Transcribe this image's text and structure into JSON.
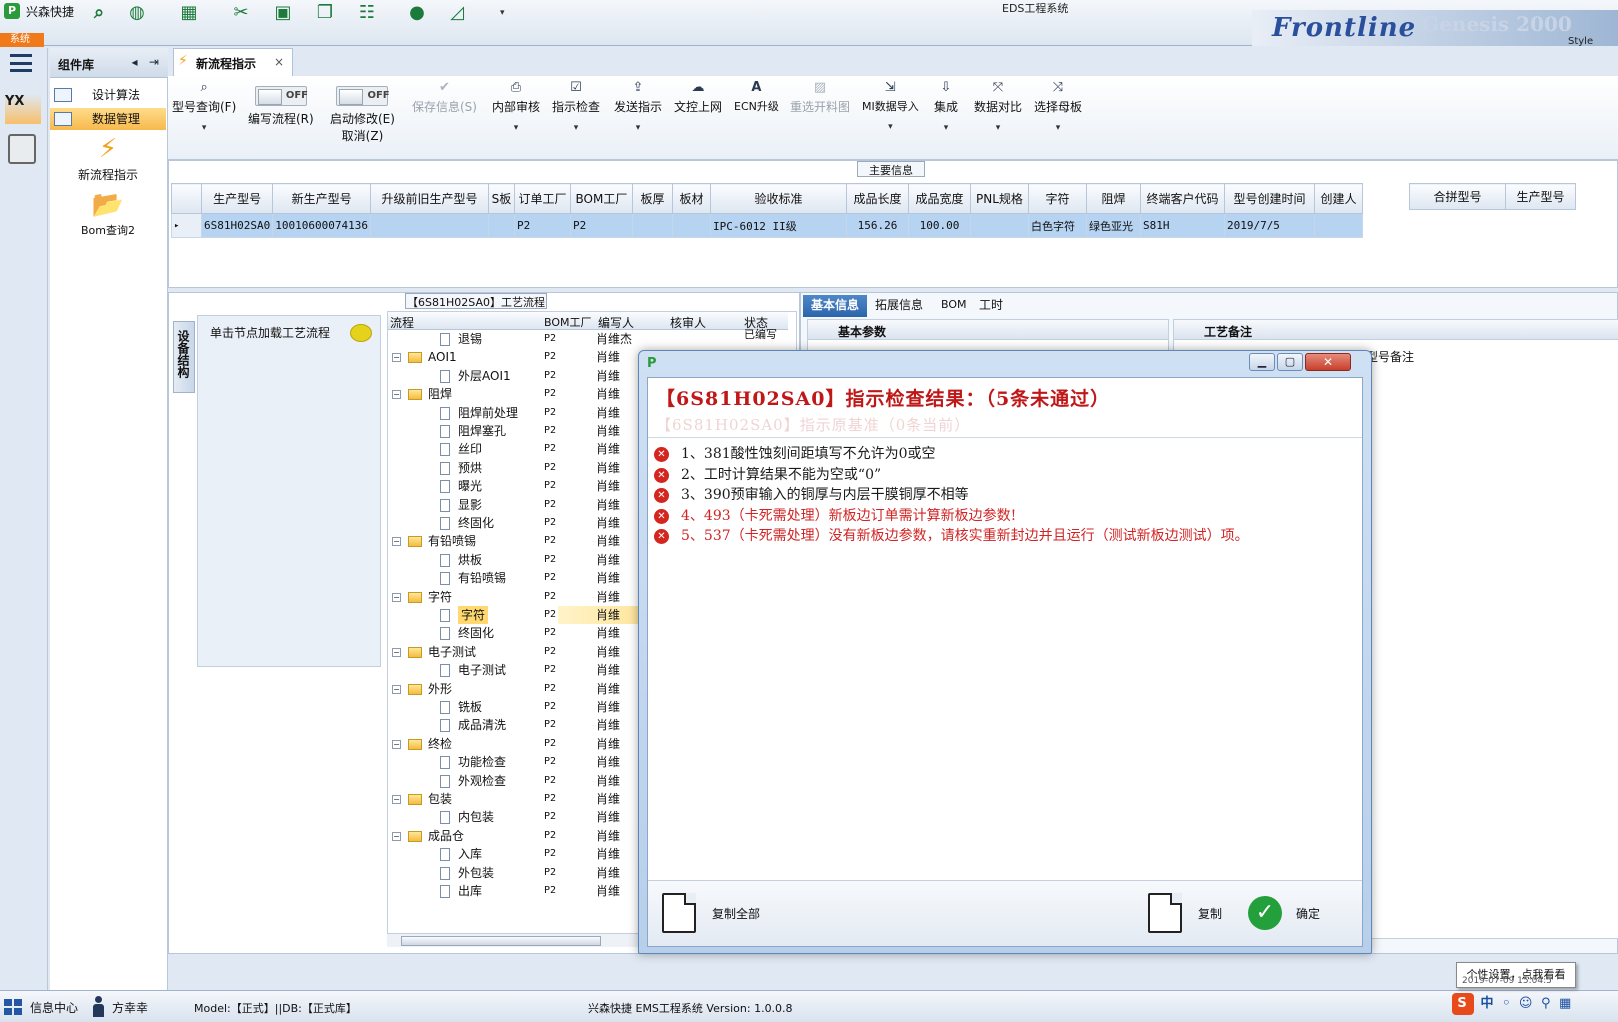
{
  "titlebar": {
    "app_name": "兴森快捷",
    "window_title": "EDS工程系统",
    "sys_tab": "系统",
    "brand_word": "Frontline",
    "brand_product": "Genesis 2000",
    "style_label": "Style"
  },
  "library": {
    "title": "组件库",
    "items": [
      {
        "label": "设计算法"
      },
      {
        "label": "数据管理"
      }
    ],
    "tools": [
      {
        "label": "新流程指示"
      },
      {
        "label": "Bom查询2"
      }
    ]
  },
  "doc_tab": {
    "label": "新流程指示"
  },
  "ribbon": {
    "buttons": [
      {
        "label": "型号查询(F)",
        "icon": "search-icon",
        "disabled": false
      },
      {
        "label": "编写流程(R)",
        "icon": "toggle-off",
        "disabled": false,
        "toggle": "OFF"
      },
      {
        "label": "启动修改(E)",
        "sub": "取消(Z)",
        "icon": "toggle-off",
        "disabled": false,
        "toggle": "OFF"
      },
      {
        "label": "保存信息(S)",
        "icon": "check-icon",
        "disabled": true
      },
      {
        "label": "内部审核",
        "icon": "printer-icon",
        "disabled": false
      },
      {
        "label": "指示检查",
        "icon": "checkbox-icon",
        "disabled": false
      },
      {
        "label": "发送指示",
        "icon": "upload-icon",
        "disabled": false
      },
      {
        "label": "文控上网",
        "icon": "cloud-icon",
        "disabled": false
      },
      {
        "label": "ECN升级",
        "icon": "ecn-icon",
        "disabled": false
      },
      {
        "label": "重选开料图",
        "icon": "image-icon",
        "disabled": true
      },
      {
        "label": "MI数据导入",
        "icon": "import-icon",
        "disabled": false
      },
      {
        "label": "集成",
        "icon": "integrate-icon",
        "disabled": false
      },
      {
        "label": "数据对比",
        "icon": "compare-icon",
        "disabled": false
      },
      {
        "label": "选择母板",
        "icon": "shuffle-icon",
        "disabled": false
      }
    ]
  },
  "main_info": {
    "caption": "主要信息",
    "columns": [
      "生产型号",
      "新生产型号",
      "升级前旧生产型号",
      "S板",
      "订单工厂",
      "BOM工厂",
      "板厚",
      "板材",
      "验收标准",
      "成品长度",
      "成品宽度",
      "PNL规格",
      "字符",
      "阻焊",
      "终端客户代码",
      "型号创建时间",
      "创建人"
    ],
    "rows": [
      [
        "6S81H02SA0",
        "10010600074136",
        "",
        "",
        "P2",
        "P2",
        "",
        "",
        "IPC-6012 II级",
        "156.26",
        "100.00",
        "",
        "白色字符",
        "绿色亚光",
        "S81H",
        "2019/7/5",
        ""
      ]
    ],
    "side_columns": [
      "合拼型号",
      "生产型号"
    ]
  },
  "flow": {
    "caption": "【6S81H02SA0】工艺流程",
    "vtab": "设备结构",
    "hint": "单击节点加载工艺流程",
    "headers": [
      "流程",
      "BOM工厂",
      "编写人",
      "核审人",
      "状态"
    ],
    "status_first": "已编写",
    "rows": [
      {
        "label": "退锡",
        "level": 2,
        "factory": "P2",
        "writer": "肖维杰"
      },
      {
        "label": "AOI1",
        "level": 1,
        "factory": "P2",
        "writer": "肖维"
      },
      {
        "label": "外层AOI1",
        "level": 2,
        "factory": "P2",
        "writer": "肖维"
      },
      {
        "label": "阻焊",
        "level": 1,
        "factory": "P2",
        "writer": "肖维"
      },
      {
        "label": "阻焊前处理",
        "level": 2,
        "factory": "P2",
        "writer": "肖维"
      },
      {
        "label": "阻焊塞孔",
        "level": 2,
        "factory": "P2",
        "writer": "肖维"
      },
      {
        "label": "丝印",
        "level": 2,
        "factory": "P2",
        "writer": "肖维"
      },
      {
        "label": "预烘",
        "level": 2,
        "factory": "P2",
        "writer": "肖维"
      },
      {
        "label": "曝光",
        "level": 2,
        "factory": "P2",
        "writer": "肖维"
      },
      {
        "label": "显影",
        "level": 2,
        "factory": "P2",
        "writer": "肖维"
      },
      {
        "label": "终固化",
        "level": 2,
        "factory": "P2",
        "writer": "肖维"
      },
      {
        "label": "有铅喷锡",
        "level": 1,
        "factory": "P2",
        "writer": "肖维"
      },
      {
        "label": "烘板",
        "level": 2,
        "factory": "P2",
        "writer": "肖维"
      },
      {
        "label": "有铅喷锡",
        "level": 2,
        "factory": "P2",
        "writer": "肖维"
      },
      {
        "label": "字符",
        "level": 1,
        "factory": "P2",
        "writer": "肖维"
      },
      {
        "label": "字符",
        "level": 2,
        "factory": "P2",
        "writer": "肖维",
        "selected": true
      },
      {
        "label": "终固化",
        "level": 2,
        "factory": "P2",
        "writer": "肖维"
      },
      {
        "label": "电子测试",
        "level": 1,
        "factory": "P2",
        "writer": "肖维"
      },
      {
        "label": "电子测试",
        "level": 2,
        "factory": "P2",
        "writer": "肖维"
      },
      {
        "label": "外形",
        "level": 1,
        "factory": "P2",
        "writer": "肖维"
      },
      {
        "label": "铣板",
        "level": 2,
        "factory": "P2",
        "writer": "肖维"
      },
      {
        "label": "成品清洗",
        "level": 2,
        "factory": "P2",
        "writer": "肖维"
      },
      {
        "label": "终检",
        "level": 1,
        "factory": "P2",
        "writer": "肖维"
      },
      {
        "label": "功能检查",
        "level": 2,
        "factory": "P2",
        "writer": "肖维"
      },
      {
        "label": "外观检查",
        "level": 2,
        "factory": "P2",
        "writer": "肖维"
      },
      {
        "label": "包装",
        "level": 1,
        "factory": "P2",
        "writer": "肖维"
      },
      {
        "label": "内包装",
        "level": 2,
        "factory": "P2",
        "writer": "肖维"
      },
      {
        "label": "成品仓",
        "level": 1,
        "factory": "P2",
        "writer": "肖维"
      },
      {
        "label": "入库",
        "level": 2,
        "factory": "P2",
        "writer": "肖维"
      },
      {
        "label": "外包装",
        "level": 2,
        "factory": "P2",
        "writer": "肖维"
      },
      {
        "label": "出库",
        "level": 2,
        "factory": "P2",
        "writer": "肖维"
      }
    ]
  },
  "right": {
    "tabs": [
      "基本信息",
      "拓展信息",
      "BOM",
      "工时"
    ],
    "basic_group": "基本参数",
    "remark_group": "工艺备注",
    "remark_col": "型号备注"
  },
  "dialog": {
    "title": "【6S81H02SA0】指示检查结果：（5条未通过）",
    "ghost": "【6S81H02SA0】指示原基准（0条当前）",
    "messages": [
      {
        "text": "1、381酸性蚀刻间距填写不允许为0或空",
        "color": "dark"
      },
      {
        "text": "2、工时计算结果不能为空或“0”",
        "color": "dark"
      },
      {
        "text": "3、390预审输入的铜厚与内层干膜铜厚不相等",
        "color": "dark"
      },
      {
        "text": "4、493（卡死需处理）新板边订单需计算新板边参数!",
        "color": "red"
      },
      {
        "text": "5、537（卡死需处理）没有新板边参数，请核实重新封边并且运行（测试新板边测试）项。",
        "color": "red"
      }
    ],
    "copy_all": "复制全部",
    "copy": "复制",
    "confirm": "确定"
  },
  "status": {
    "info_center": "信息中心",
    "user": "方幸幸",
    "model": "Model:【正式】||DB:【正式库】",
    "version": "兴森快捷 EMS工程系统 Version: 1.0.0.8",
    "tooltip": "个性设置，点我看看",
    "tray": "中",
    "clock": "2019-07-09 15:04:5"
  }
}
